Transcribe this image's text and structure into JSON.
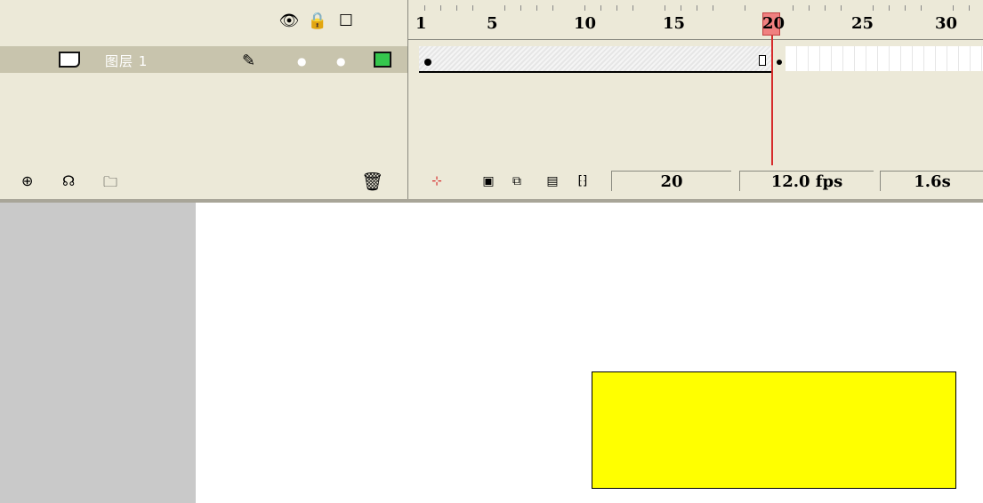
{
  "layers": {
    "header_icons": [
      "eye-icon",
      "lock-icon",
      "outline-icon"
    ],
    "rows": [
      {
        "name": "图层 1"
      }
    ],
    "footer_icons": [
      "insert-layer-icon",
      "add-motion-guide-icon",
      "insert-folder-icon",
      "delete-layer-icon"
    ]
  },
  "timeline": {
    "ruler_labels": [
      "1",
      "5",
      "10",
      "15",
      "20",
      "25",
      "30"
    ],
    "current_frame": 20,
    "frame_field": "20",
    "fps_field": "12.0 fps",
    "time_field": "1.6s"
  },
  "stage": {
    "rect_fill": "#ffff00"
  }
}
